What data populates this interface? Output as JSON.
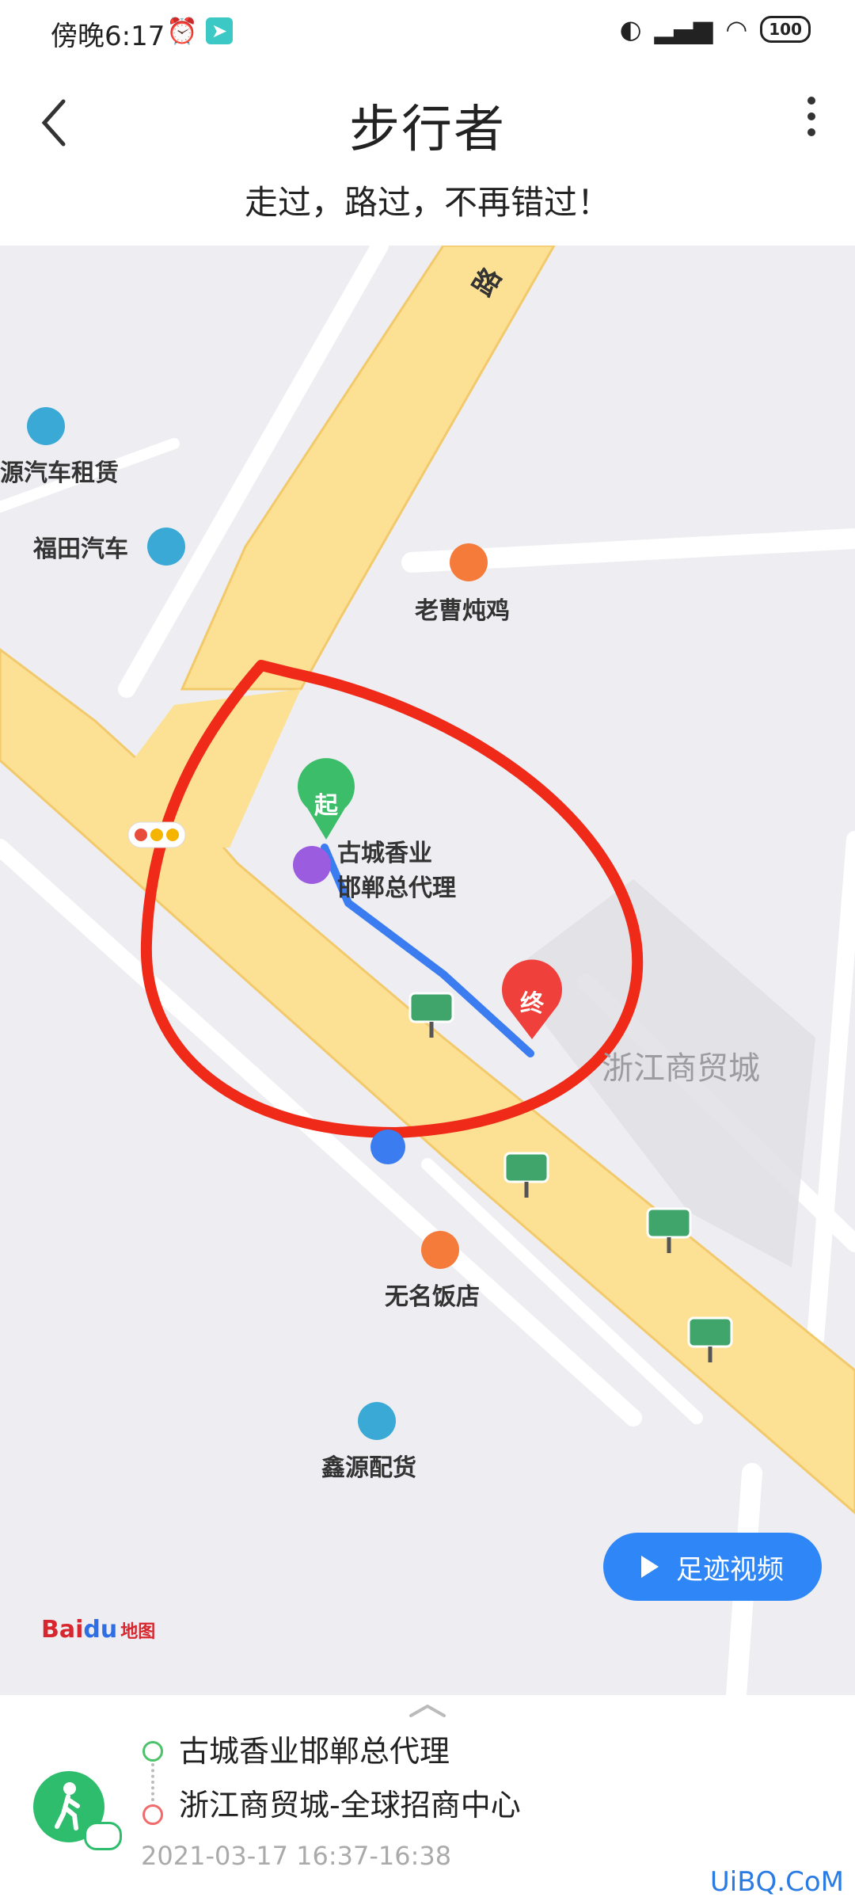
{
  "status_bar": {
    "time": "傍晚6:17",
    "battery": "100"
  },
  "header": {
    "title": "步行者",
    "subtitle": "走过，路过，不再错过！"
  },
  "map": {
    "road_label": "路",
    "pois": [
      {
        "label": "源汽车租赁",
        "icon": "car-icon"
      },
      {
        "label": "福田汽车",
        "icon": "car-icon"
      },
      {
        "label": "老曹炖鸡",
        "icon": "food-icon"
      },
      {
        "label": "古城香业",
        "icon": "shop-icon"
      },
      {
        "label": "邯郸总代理",
        "icon": ""
      },
      {
        "label": "浙江商贸城",
        "icon": ""
      },
      {
        "label": "无名饭店",
        "icon": "food-icon"
      },
      {
        "label": "鑫源配货",
        "icon": "truck-icon"
      }
    ],
    "start_marker": "起",
    "end_marker": "终",
    "video_button": "足迹视频",
    "logo": {
      "text": "Bai",
      "text2": "du",
      "suffix": "地图"
    },
    "colors": {
      "road": "#fce094",
      "route": "#3b7cf0",
      "annotation": "#f02a18",
      "start": "#3bbd6a",
      "end": "#f0403c"
    }
  },
  "sheet": {
    "from": "古城香业邯郸总代理",
    "to": "浙江商贸城-全球招商中心",
    "time_range": "2021-03-17 16:37-16:38",
    "watermark": "UiBQ.CoM"
  }
}
